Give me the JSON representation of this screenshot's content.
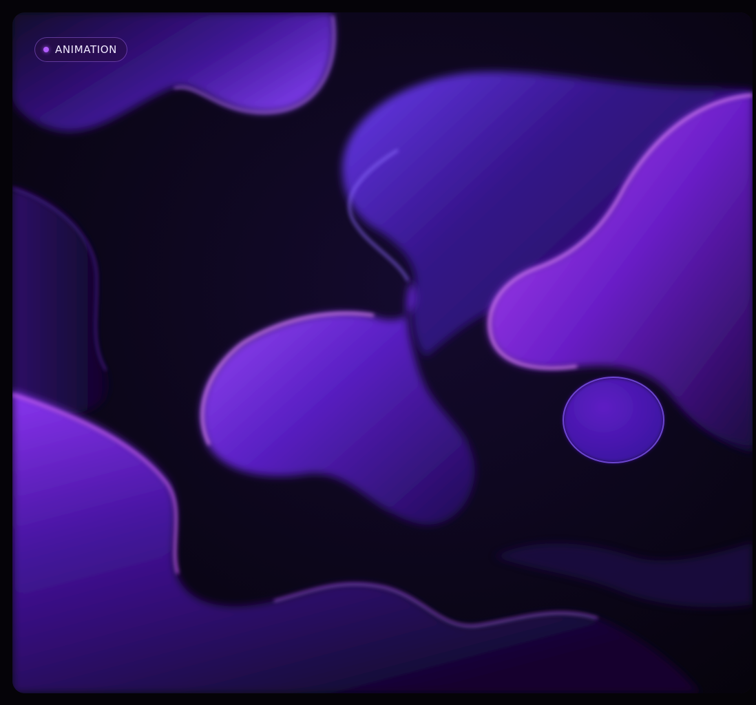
{
  "badge": {
    "label": "ANIMATION",
    "dot_color": "#b25cff"
  },
  "palette": {
    "background": "#07040f",
    "blob_dark": "#1a0a3d",
    "blob_mid": "#4a1aa8",
    "blob_light": "#b04cff",
    "rim_light": "#e07bff"
  }
}
